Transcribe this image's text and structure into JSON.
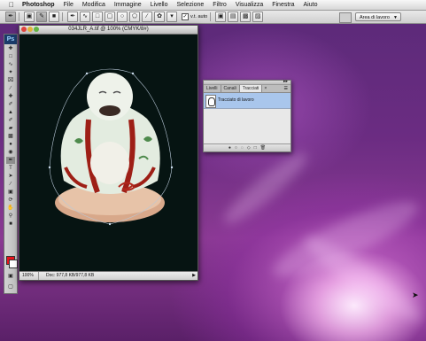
{
  "menubar": {
    "apple": "",
    "items": [
      "Photoshop",
      "File",
      "Modifica",
      "Immagine",
      "Livello",
      "Selezione",
      "Filtro",
      "Visualizza",
      "Finestra",
      "Aiuto"
    ]
  },
  "options": {
    "auto_label": "v.t. auto",
    "workspace_label": "Area di lavoro"
  },
  "toolbox": {
    "logo": "Ps",
    "foreground_color": "#e8141c",
    "background_color": "#ffffff"
  },
  "document": {
    "title": "034JLR_A.tif @ 100% (CMYK/8#)",
    "zoom": "100%",
    "info": "Doc: 977,8 KB/977,8 KB"
  },
  "paths_panel": {
    "tabs": [
      "Livelli",
      "Canali",
      "Tracciati"
    ],
    "active_tab": "Tracciati",
    "rows": [
      {
        "name": "Tracciato di lavoro"
      }
    ]
  },
  "colors": {
    "desktop": "#6b2c82",
    "selection": "#a9c6ec"
  }
}
